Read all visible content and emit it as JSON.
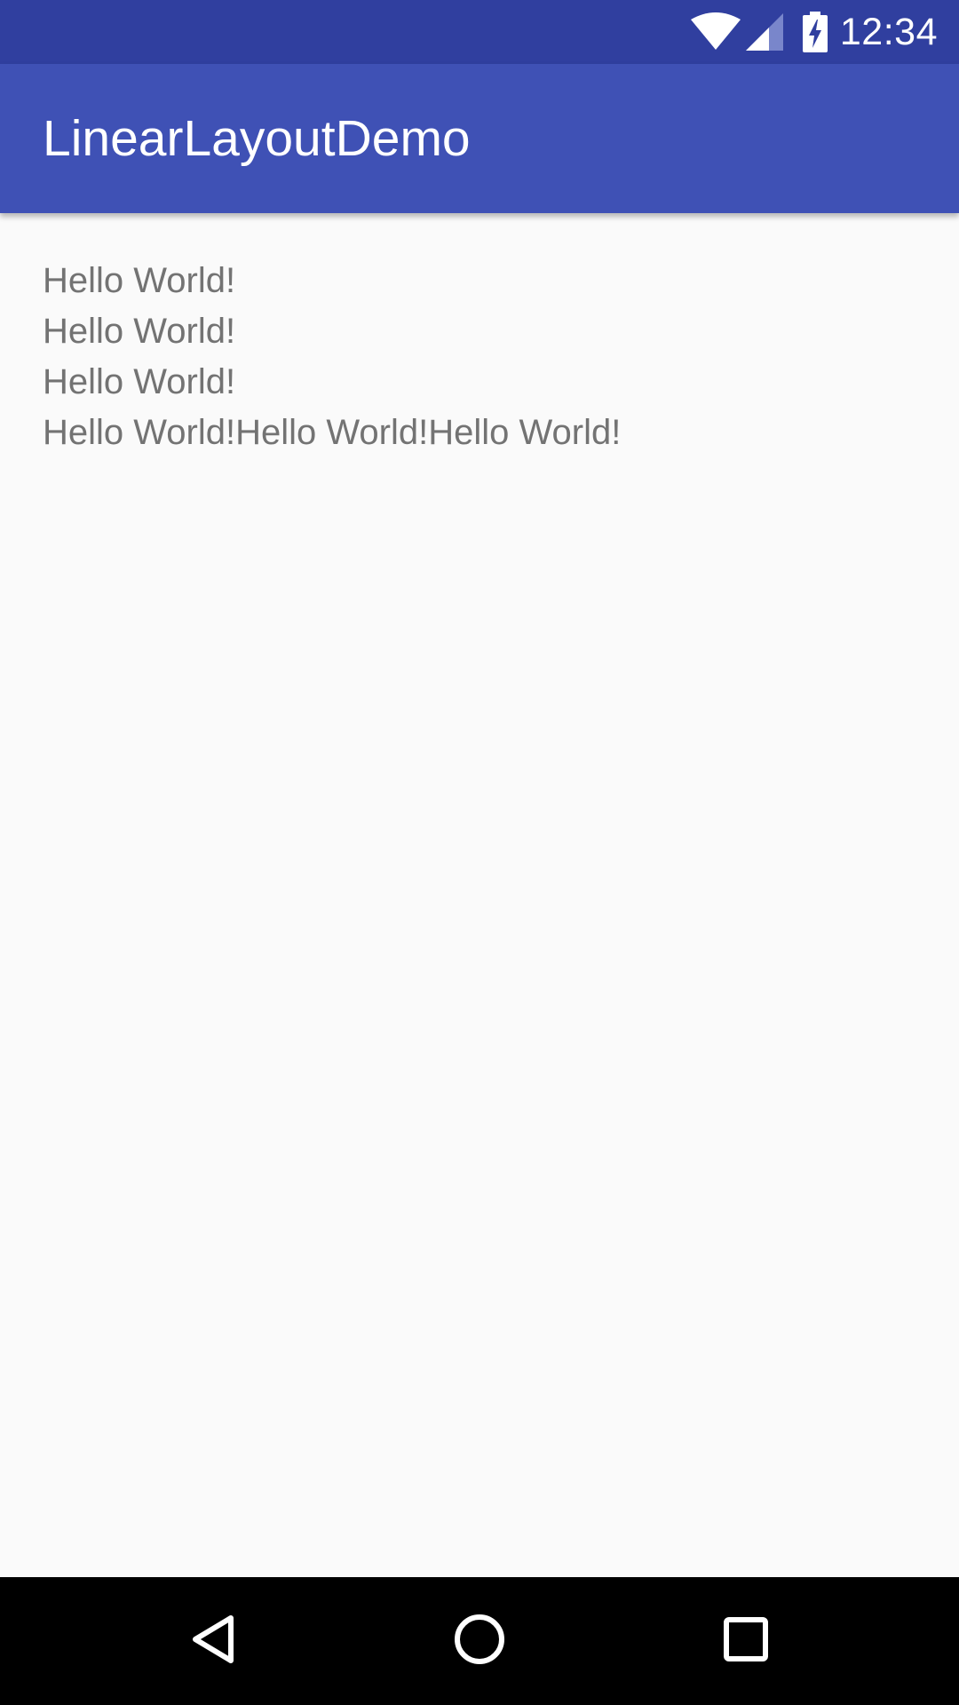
{
  "status_bar": {
    "time": "12:34",
    "icons": [
      "wifi-icon",
      "signal-icon",
      "battery-charging-icon"
    ],
    "background_color": "#303f9f"
  },
  "app_bar": {
    "title": "LinearLayoutDemo",
    "background_color": "#3f51b5"
  },
  "content": {
    "lines": [
      "Hello World!",
      "Hello World!",
      "Hello World!"
    ],
    "inline_row": [
      "Hello World!",
      "Hello World!",
      "Hello World!"
    ],
    "text_color": "#737373"
  },
  "nav_bar": {
    "buttons": [
      "back-icon",
      "home-icon",
      "recents-icon"
    ]
  }
}
